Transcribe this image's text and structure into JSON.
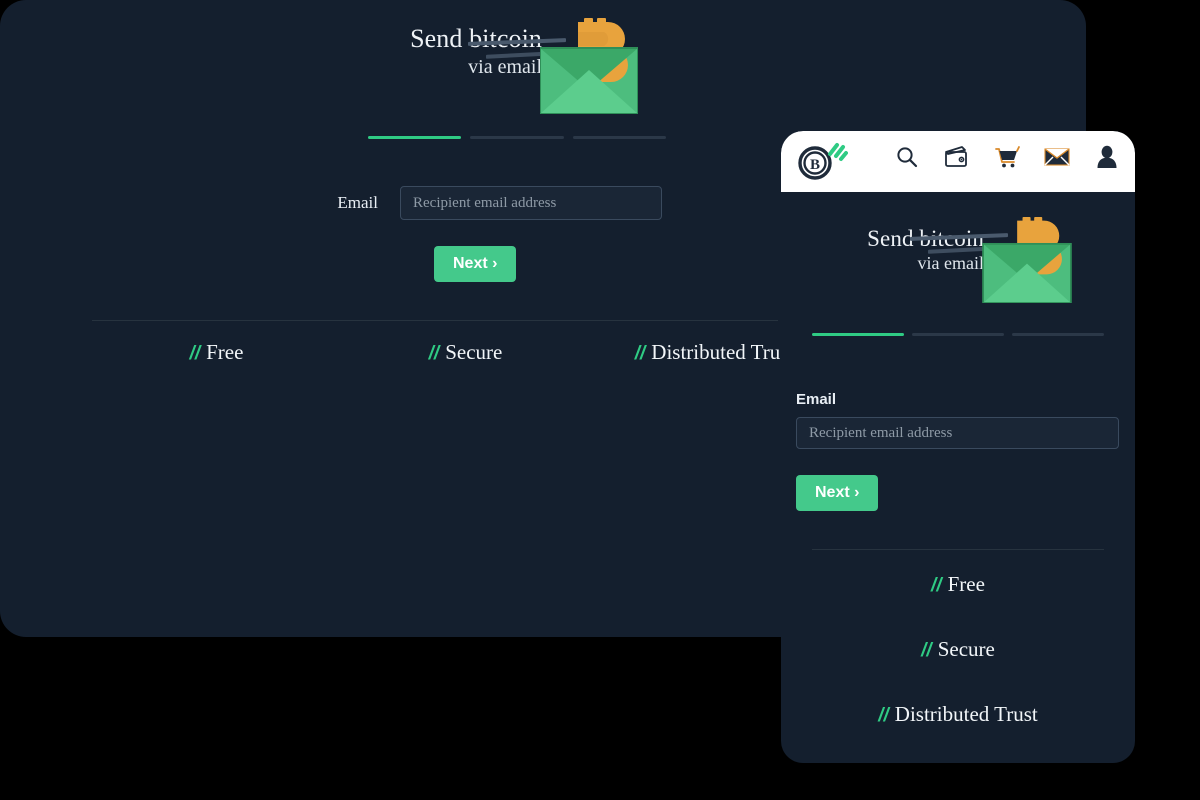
{
  "colors": {
    "page_background": "#000000",
    "panel_background": "#141f2e",
    "accent_green": "#2fcb84",
    "button_green": "#44c98b",
    "text_light": "#f2f6f9",
    "header_white": "#ffffff",
    "bitcoin_orange": "#e8a33d",
    "envelope_green": "#4dbd7e",
    "input_border": "#3a4a5e",
    "divider": "#27333f",
    "step_inactive": "#2b3848"
  },
  "desktop": {
    "hero": {
      "line1": "Send bitcoin",
      "line2": "via email",
      "envelope_icon": "bitcoin-envelope-icon",
      "streak_icon": "motion-streak-icon"
    },
    "steps": [
      {
        "name": "step-1",
        "active": true
      },
      {
        "name": "step-2",
        "active": false
      },
      {
        "name": "step-3",
        "active": false
      }
    ],
    "form": {
      "email_label": "Email",
      "email_value": "",
      "email_placeholder": "Recipient email address",
      "next_label": "Next ›"
    },
    "features": [
      {
        "marker": "//",
        "label": "Free"
      },
      {
        "marker": "//",
        "label": "Secure"
      },
      {
        "marker": "//",
        "label": "Distributed Trust"
      }
    ]
  },
  "mobile": {
    "header": {
      "logo_name": "bitcoin-b-logo",
      "icons": [
        {
          "name": "search-icon",
          "label": "Search"
        },
        {
          "name": "wallet-icon",
          "label": "Wallet"
        },
        {
          "name": "cart-icon",
          "label": "Cart"
        },
        {
          "name": "mail-icon",
          "label": "Mail"
        },
        {
          "name": "user-icon",
          "label": "Account"
        }
      ]
    },
    "hero": {
      "line1": "Send bitcoin",
      "line2": "via email",
      "envelope_icon": "bitcoin-envelope-icon",
      "streak_icon": "motion-streak-icon"
    },
    "steps": [
      {
        "name": "step-1",
        "active": true
      },
      {
        "name": "step-2",
        "active": false
      },
      {
        "name": "step-3",
        "active": false
      }
    ],
    "form": {
      "email_label": "Email",
      "email_value": "",
      "email_placeholder": "Recipient email address",
      "next_label": "Next ›"
    },
    "features": [
      {
        "marker": "//",
        "label": "Free"
      },
      {
        "marker": "//",
        "label": "Secure"
      },
      {
        "marker": "//",
        "label": "Distributed Trust"
      }
    ]
  }
}
